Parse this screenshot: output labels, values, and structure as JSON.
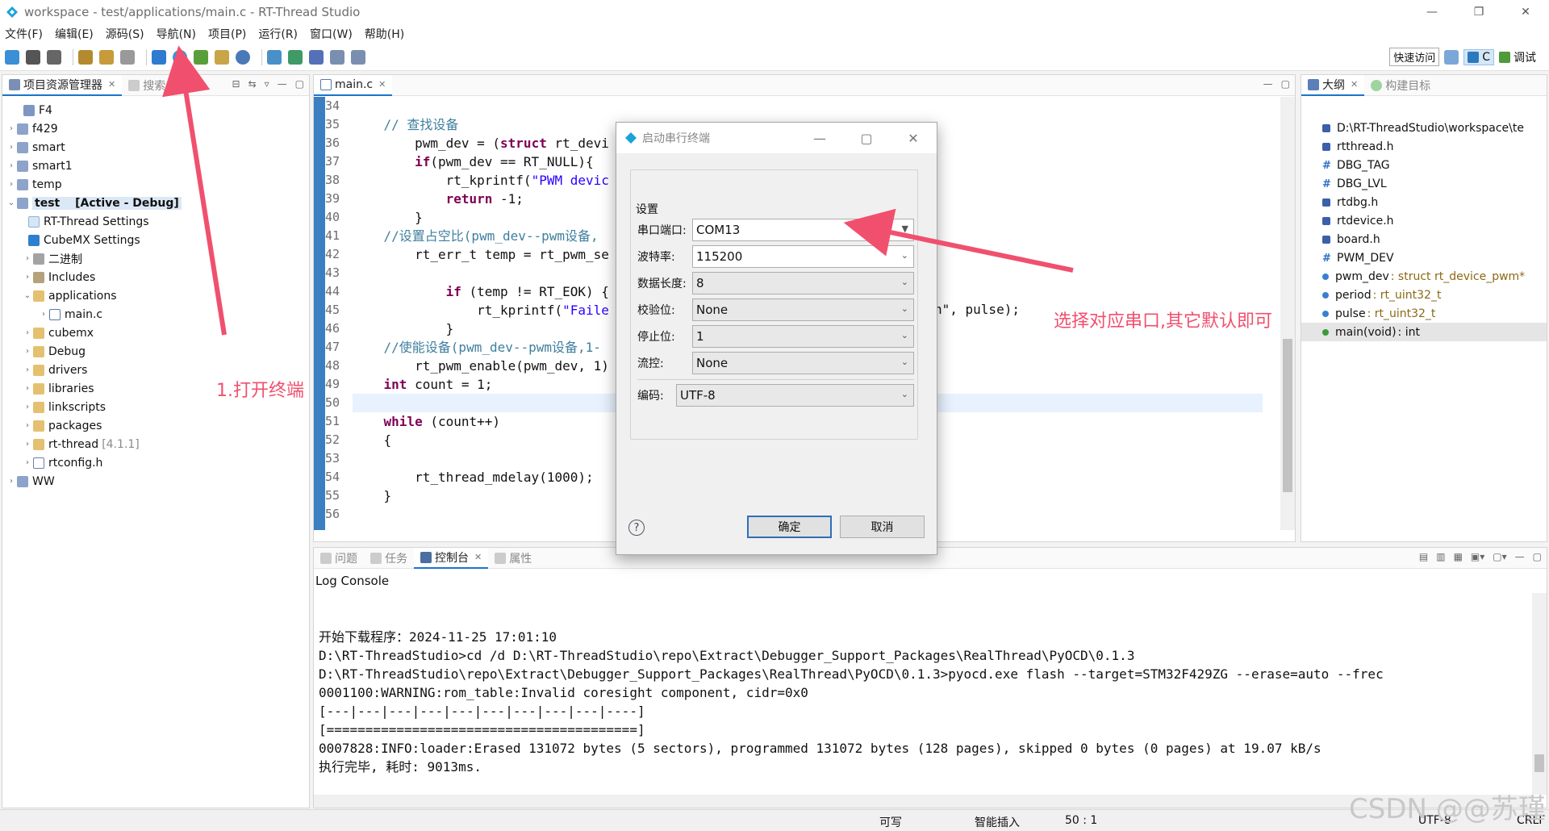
{
  "window": {
    "title": "workspace - test/applications/main.c - RT-Thread Studio"
  },
  "menu": [
    "文件(F)",
    "编辑(E)",
    "源码(S)",
    "导航(N)",
    "项目(P)",
    "运行(R)",
    "窗口(W)",
    "帮助(H)"
  ],
  "toolbar": {
    "quick_access": "快速访问",
    "perspective_c": "C",
    "perspective_debug": "调试"
  },
  "explorer": {
    "tab_label": "项目资源管理器",
    "search_tab": "搜索",
    "items": [
      {
        "label": "F4",
        "extra": ""
      },
      {
        "label": "f429",
        "extra": ""
      },
      {
        "label": "smart",
        "extra": ""
      },
      {
        "label": "smart1",
        "extra": ""
      },
      {
        "label": "temp",
        "extra": ""
      },
      {
        "label": "test",
        "extra": "[Active - Debug]"
      },
      {
        "label": "RT-Thread Settings",
        "extra": ""
      },
      {
        "label": "CubeMX Settings",
        "extra": ""
      },
      {
        "label": "二进制",
        "extra": ""
      },
      {
        "label": "Includes",
        "extra": ""
      },
      {
        "label": "applications",
        "extra": ""
      },
      {
        "label": "main.c",
        "extra": ""
      },
      {
        "label": "cubemx",
        "extra": ""
      },
      {
        "label": "Debug",
        "extra": ""
      },
      {
        "label": "drivers",
        "extra": ""
      },
      {
        "label": "libraries",
        "extra": ""
      },
      {
        "label": "linkscripts",
        "extra": ""
      },
      {
        "label": "packages",
        "extra": ""
      },
      {
        "label": "rt-thread",
        "extra": "[4.1.1]"
      },
      {
        "label": "rtconfig.h",
        "extra": ""
      },
      {
        "label": "WW",
        "extra": ""
      }
    ]
  },
  "editor": {
    "tab_label": "main.c",
    "line_numbers": [
      "34",
      "35",
      "36",
      "37",
      "38",
      "39",
      "40",
      "41",
      "42",
      "43",
      "44",
      "45",
      "46",
      "47",
      "48",
      "49",
      "50",
      "51",
      "52",
      "53",
      "54",
      "55",
      "56"
    ],
    "lines": [
      "",
      "    // 查找设备",
      "        pwm_dev = (struct rt_devi",
      "        if(pwm_dev == RT_NULL){",
      "            rt_kprintf(\"PWM devic",
      "            return -1;",
      "        }",
      "    //设置占空比(pwm_dev--pwm设备,",
      "        rt_err_t temp = rt_pwm_se",
      "",
      "            if (temp != RT_EOK) {",
      "                rt_kprintf(\"Faile",
      "            }",
      "    //使能设备(pwm_dev--pwm设备,1-",
      "        rt_pwm_enable(pwm_dev, 1)",
      "    int count = 1;",
      "",
      "    while (count++)",
      "    {",
      "",
      "        rt_thread_mdelay(1000);",
      "    }",
      ""
    ],
    "line45_tail": "n\", pulse);"
  },
  "outline": {
    "tab_label": "大纲",
    "build_tab": "构建目标",
    "items": [
      {
        "name": "D:\\RT-ThreadStudio\\workspace\\te",
        "type": ""
      },
      {
        "name": "rtthread.h",
        "type": ""
      },
      {
        "name": "DBG_TAG",
        "type": ""
      },
      {
        "name": "DBG_LVL",
        "type": ""
      },
      {
        "name": "rtdbg.h",
        "type": ""
      },
      {
        "name": "rtdevice.h",
        "type": ""
      },
      {
        "name": "board.h",
        "type": ""
      },
      {
        "name": "PWM_DEV",
        "type": ""
      },
      {
        "name": "pwm_dev",
        "type": ": struct rt_device_pwm*"
      },
      {
        "name": "period",
        "type": ": rt_uint32_t"
      },
      {
        "name": "pulse",
        "type": ": rt_uint32_t"
      },
      {
        "name": "main(void)",
        "type": ": int"
      }
    ]
  },
  "console": {
    "tabs": [
      "问题",
      "任务",
      "控制台",
      "属性"
    ],
    "title": "Log Console",
    "lines": [
      "开始下载程序：2024-11-25 17:01:10",
      "D:\\RT-ThreadStudio>cd /d D:\\RT-ThreadStudio\\repo\\Extract\\Debugger_Support_Packages\\RealThread\\PyOCD\\0.1.3",
      "D:\\RT-ThreadStudio\\repo\\Extract\\Debugger_Support_Packages\\RealThread\\PyOCD\\0.1.3>pyocd.exe flash --target=STM32F429ZG --erase=auto --frec",
      "0001100:WARNING:rom_table:Invalid coresight component, cidr=0x0",
      "[---|---|---|---|---|---|---|---|---|----]",
      "[========================================]",
      "0007828:INFO:loader:Erased 131072 bytes (5 sectors), programmed 131072 bytes (128 pages), skipped 0 bytes (0 pages) at 19.07 kB/s",
      "执行完毕, 耗时: 9013ms."
    ]
  },
  "statusbar": {
    "writable": "可写",
    "insert": "智能插入",
    "position": "50 : 1",
    "encoding": "UTF-8",
    "eol": "CRLF"
  },
  "dialog": {
    "title": "启动串行终端",
    "group": "设置",
    "port_label": "串口端口:",
    "port_value": "COM13",
    "baud_label": "波特率:",
    "baud_value": "115200",
    "databits_label": "数据长度:",
    "databits_value": "8",
    "parity_label": "校验位:",
    "parity_value": "None",
    "stopbits_label": "停止位:",
    "stopbits_value": "1",
    "flow_label": "流控:",
    "flow_value": "None",
    "encoding_label": "编码:",
    "encoding_value": "UTF-8",
    "ok": "确定",
    "cancel": "取消"
  },
  "annotations": {
    "open_terminal": "1.打开终端",
    "choose_port": "选择对应串口,其它默认即可"
  },
  "watermark": "CSDN @@苏瑾",
  "colors": {
    "accent": "#1b75c9",
    "annotation": "#f0506e",
    "gutter": "#3b7ec2"
  }
}
